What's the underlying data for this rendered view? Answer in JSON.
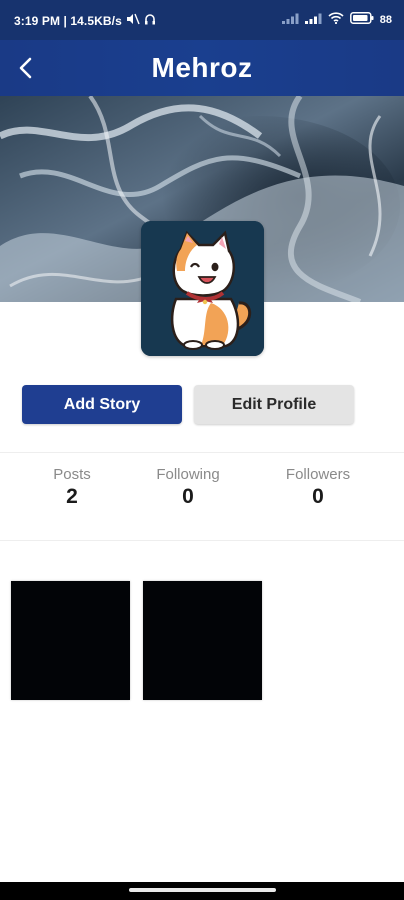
{
  "status_bar": {
    "time_speed": "3:19 PM | 14.5KB/s",
    "battery": "88"
  },
  "app_bar": {
    "title": "Mehroz",
    "back_icon": "chevron-left-icon"
  },
  "profile": {
    "avatar_icon": "cat-avatar",
    "cover_icon": "ocean-cover-art"
  },
  "actions": {
    "add_story": "Add Story",
    "edit_profile": "Edit Profile"
  },
  "stats": {
    "posts_label": "Posts",
    "posts_value": "2",
    "following_label": "Following",
    "following_value": "0",
    "followers_label": "Followers",
    "followers_value": "0"
  },
  "colors": {
    "primary": "#1f3e91",
    "status_bar": "#17336e",
    "button_secondary": "#e4e4e4"
  }
}
